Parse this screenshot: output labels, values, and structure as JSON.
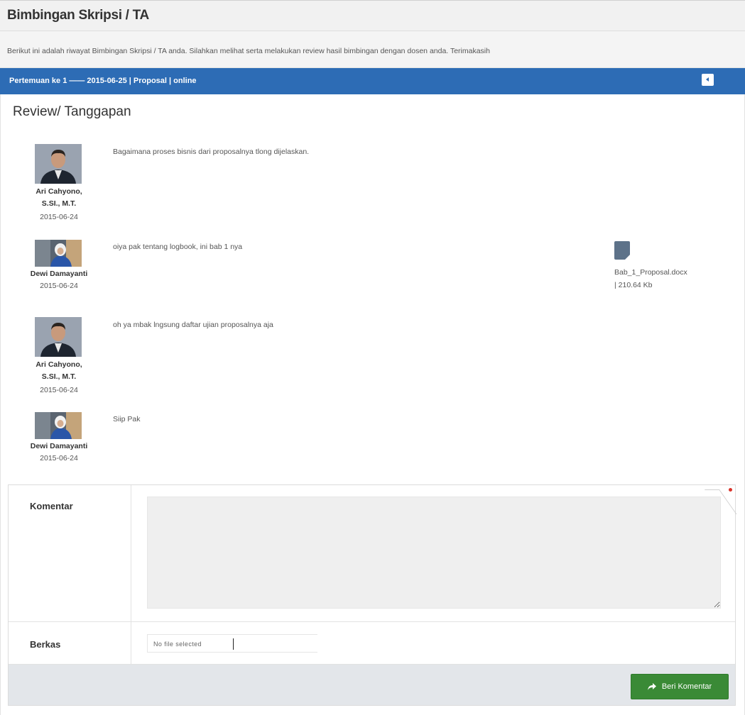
{
  "page": {
    "title": "Bimbingan Skripsi / TA"
  },
  "intro": {
    "text": "Berikut ini adalah riwayat Bimbingan Skripsi / TA anda. Silahkan melihat serta melakukan review hasil bimbingan dengan dosen anda. Terimakasih"
  },
  "meeting": {
    "label": "Pertemuan ke 1 —— 2015-06-25 | Proposal | online",
    "colors": {
      "bar": "#2d6cb5"
    }
  },
  "review": {
    "title": "Review/ Tanggapan",
    "entries": [
      {
        "name_line1": "Ari Cahyono,",
        "name_line2": "S.SI., M.T.",
        "date": "2015-06-24",
        "message": "Bagaimana proses bisnis dari proposalnya tlong dijelaskan."
      },
      {
        "name_line1": "Dewi Damayanti",
        "date": "2015-06-24",
        "message": "oiya pak tentang logbook, ini bab 1 nya",
        "attachment": {
          "icon": "document-icon",
          "file_name": "Bab_1_Proposal.docx",
          "file_size": "| 210.64 Kb"
        }
      },
      {
        "name_line1": "Ari Cahyono,",
        "name_line2": "S.SI., M.T.",
        "date": "2015-06-24",
        "message": "oh ya mbak lngsung daftar ujian proposalnya aja"
      },
      {
        "name_line1": "Dewi Damayanti",
        "date": "2015-06-24",
        "message": "Siip Pak"
      }
    ]
  },
  "form": {
    "comment_label": "Komentar",
    "comment_value": "",
    "file_label": "Berkas",
    "file_status": "No file selected",
    "submit_label": "Beri Komentar",
    "submit_icon": "share-arrow-icon",
    "colors": {
      "submit": "#3a8a36",
      "footer": "#e3e6ea"
    }
  }
}
